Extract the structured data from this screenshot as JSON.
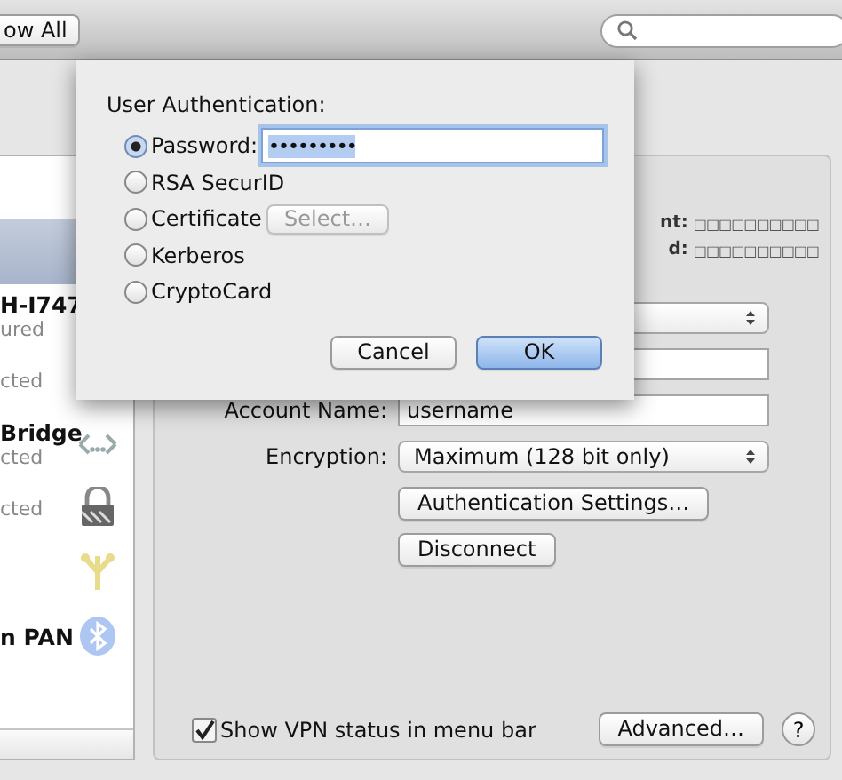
{
  "toolbar": {
    "show_all_button": "ow All"
  },
  "sidebar": {
    "items": [
      {
        "selected": true
      },
      {
        "name": "H-I747",
        "status": "ured",
        "selected": false,
        "kind": "plain"
      },
      {
        "status": "cted",
        "selected": false,
        "kind": "plain"
      },
      {
        "name": "Bridge",
        "status": "cted",
        "selected": false,
        "kind": "bridge"
      },
      {
        "status": "cted",
        "selected": false,
        "kind": "vpn"
      },
      {
        "selected": false,
        "kind": "firewire"
      },
      {
        "name": "n PAN",
        "selected": false,
        "kind": "bluetooth"
      }
    ]
  },
  "stats": [
    {
      "label": "nt:",
      "value": "□□□□□□□□□□"
    },
    {
      "label": "d:",
      "value": "□□□□□□□□□□"
    }
  ],
  "form": {
    "account_name": {
      "label": "Account Name:",
      "value": "username"
    },
    "encryption": {
      "label": "Encryption:",
      "value": "Maximum (128 bit only)"
    },
    "buttons": [
      "Authentication Settings…",
      "Disconnect"
    ]
  },
  "show_status_checkbox": {
    "label": "Show VPN status in menu bar",
    "checked": true
  },
  "advanced_button": "Advanced…",
  "help_button": "?",
  "sheet": {
    "title": "User Authentication:",
    "options": [
      {
        "label": "Password:",
        "selected": true,
        "kind": "field",
        "value": "•••••••••"
      },
      {
        "label": "RSA SecurID",
        "selected": false,
        "kind": "plain"
      },
      {
        "label": "Certificate",
        "selected": false,
        "kind": "button",
        "button": {
          "label": "Select…",
          "disabled": true
        }
      },
      {
        "label": "Kerberos",
        "selected": false,
        "kind": "plain"
      },
      {
        "label": "CryptoCard",
        "selected": false,
        "kind": "plain"
      }
    ],
    "buttons": [
      {
        "label": "Cancel",
        "default": false
      },
      {
        "label": "OK",
        "default": true
      }
    ]
  }
}
